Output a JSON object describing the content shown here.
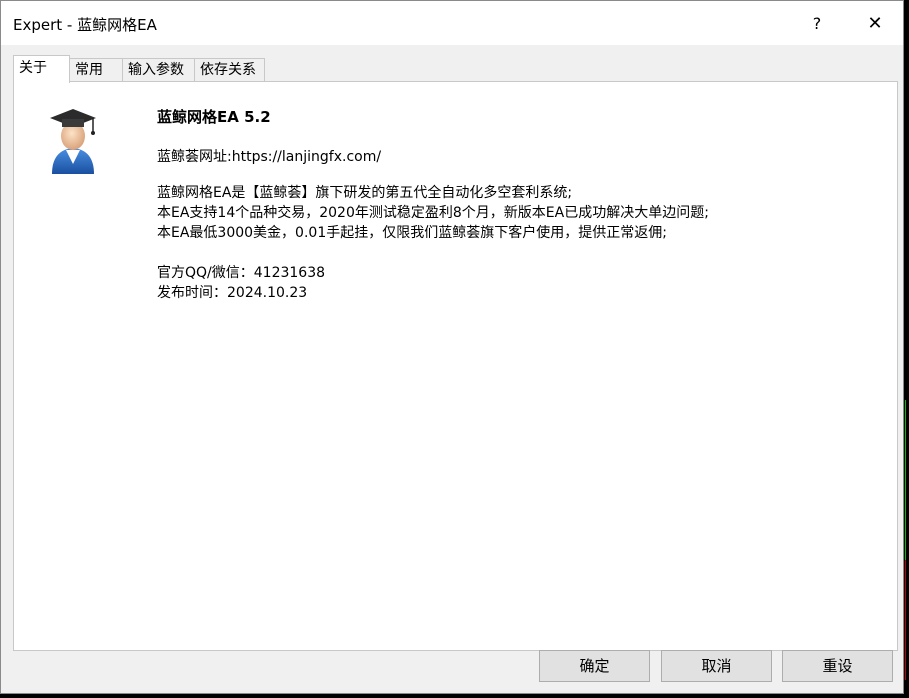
{
  "window": {
    "title": "Expert - 蓝鲸网格EA",
    "help_label": "?",
    "close_label": "✕"
  },
  "tabs": [
    {
      "label": "关于"
    },
    {
      "label": "常用"
    },
    {
      "label": "输入参数"
    },
    {
      "label": "依存关系"
    }
  ],
  "about": {
    "icon": "graduate-user-icon",
    "ea_title": "蓝鲸网格EA 5.2",
    "website": "蓝鲸荟网址:https://lanjingfx.com/",
    "description_lines": [
      "蓝鲸网格EA是【蓝鲸荟】旗下研发的第五代全自动化多空套利系统;",
      "本EA支持14个品种交易，2020年测试稳定盈利8个月，新版本EA已成功解决大单边问题;",
      "本EA最低3000美金，0.01手起挂，仅限我们蓝鲸荟旗下客户使用，提供正常返佣;"
    ],
    "contact_lines": [
      "官方QQ/微信：41231638",
      "发布时间：2024.10.23"
    ]
  },
  "buttons": {
    "ok": "确定",
    "cancel": "取消",
    "reset": "重设"
  },
  "colors": {
    "dialog_bg": "#f0f0f0",
    "panel_bg": "#ffffff",
    "chart_bg": "#000000",
    "chart_green": "#00c000",
    "chart_red": "#c00000"
  }
}
